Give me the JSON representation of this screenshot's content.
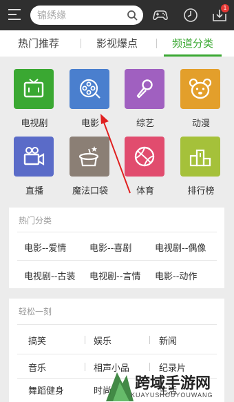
{
  "header": {
    "search_placeholder": "锦绣缘",
    "notification_count": "1"
  },
  "tabs": [
    {
      "label": "热门推荐"
    },
    {
      "label": "影视爆点"
    },
    {
      "label": "频道分类"
    }
  ],
  "channels": [
    {
      "label": "电视剧",
      "color": "#3aa832",
      "icon": "tv-icon"
    },
    {
      "label": "电影",
      "color": "#4a7fce",
      "icon": "film-reel-icon"
    },
    {
      "label": "综艺",
      "color": "#a060c0",
      "icon": "microphone-icon"
    },
    {
      "label": "动漫",
      "color": "#e39f2b",
      "icon": "bear-icon"
    },
    {
      "label": "直播",
      "color": "#5a6bc8",
      "icon": "video-camera-icon"
    },
    {
      "label": "魔法口袋",
      "color": "#8b7f75",
      "icon": "magic-hat-icon"
    },
    {
      "label": "体育",
      "color": "#e14c6e",
      "icon": "ball-icon"
    },
    {
      "label": "排行榜",
      "color": "#a5c13a",
      "icon": "podium-icon"
    }
  ],
  "hot_categories": {
    "title": "热门分类",
    "items": [
      "电影--爱情",
      "电影--喜剧",
      "电视剧--偶像",
      "电视剧--古装",
      "电视剧--言情",
      "电影--动作"
    ]
  },
  "relax": {
    "title": "轻松一刻",
    "items": [
      "搞笑",
      "娱乐",
      "新闻",
      "音乐",
      "相声小品",
      "纪录片",
      "舞蹈健身",
      "时尚",
      "生活"
    ]
  },
  "watermark": {
    "text": "跨域手游网",
    "sub": "KUAYUSHOUYOUWANG"
  }
}
